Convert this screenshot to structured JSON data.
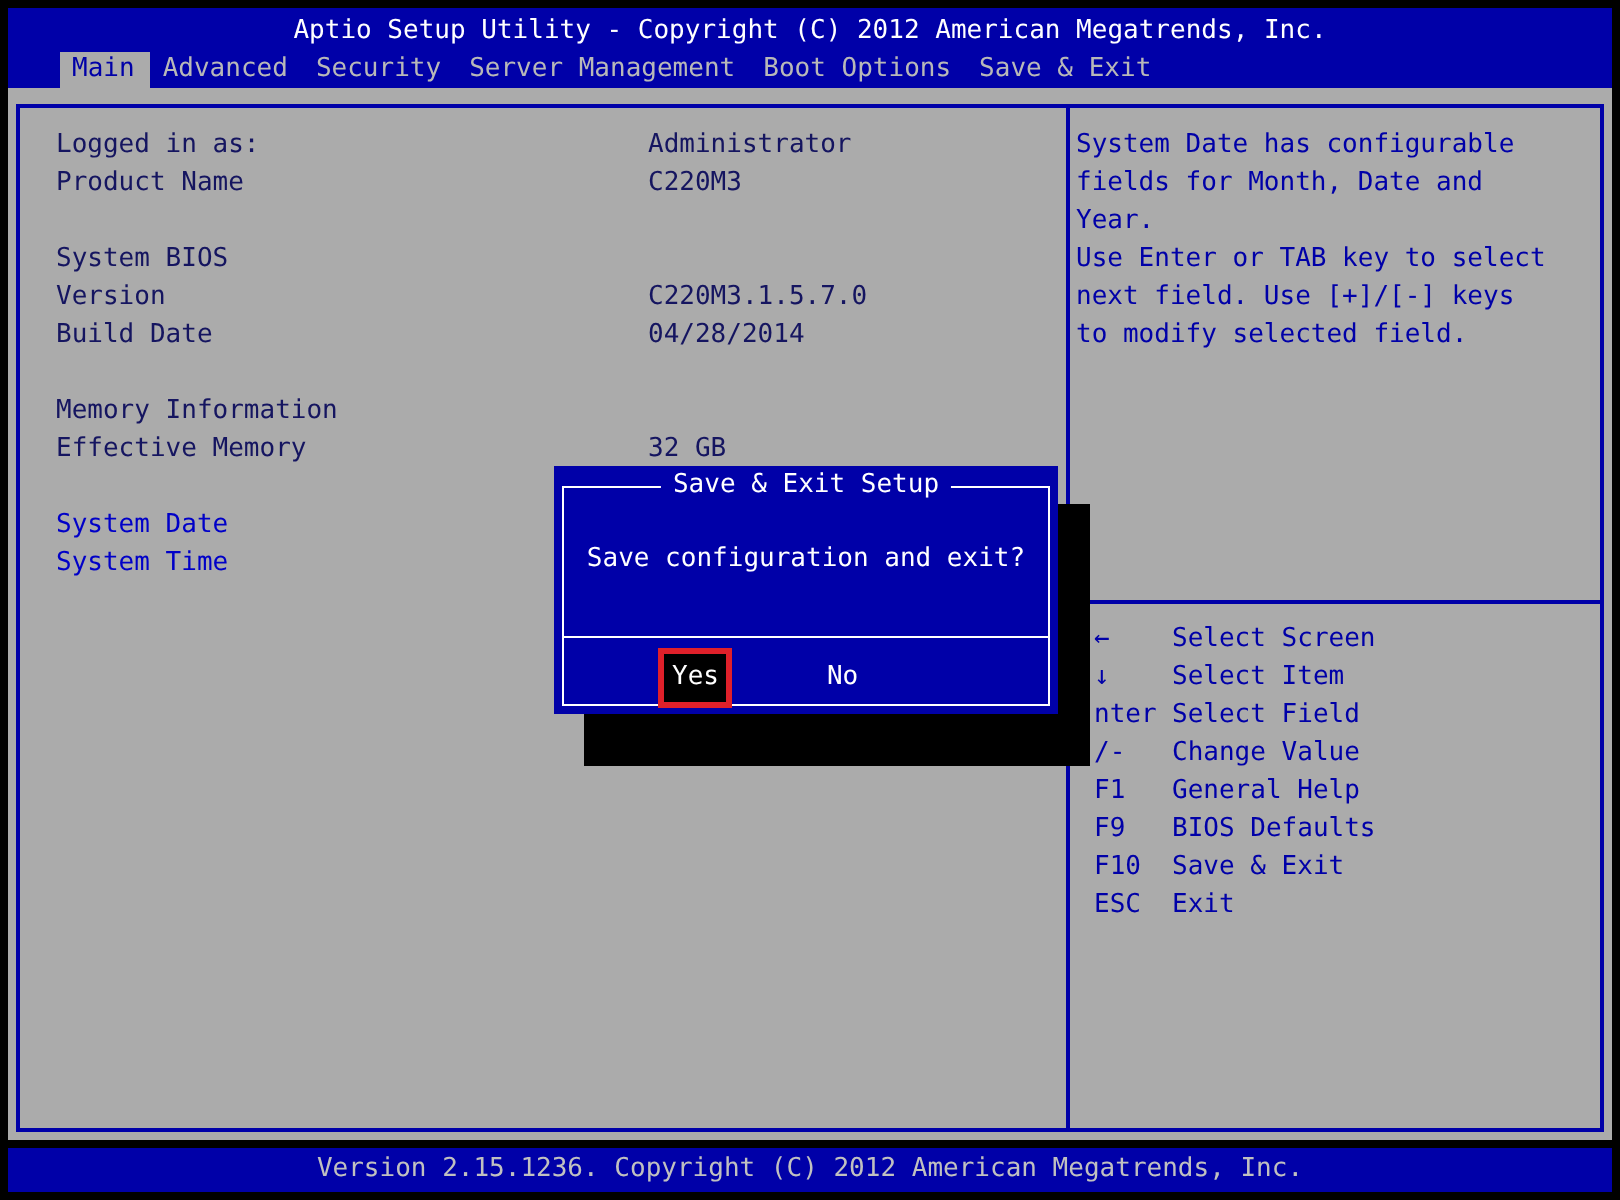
{
  "window": {
    "title": "Aptio Setup Utility - Copyright (C) 2012 American Megatrends, Inc."
  },
  "tabs": [
    {
      "label": "Main",
      "selected": true
    },
    {
      "label": "Advanced",
      "selected": false
    },
    {
      "label": "Security",
      "selected": false
    },
    {
      "label": "Server Management",
      "selected": false
    },
    {
      "label": "Boot Options",
      "selected": false
    },
    {
      "label": "Save & Exit",
      "selected": false
    }
  ],
  "settings": [
    [
      {
        "label": "Logged in as:",
        "value": "Administrator",
        "kind": "info"
      },
      {
        "label": "Product Name",
        "value": "C220M3",
        "kind": "info"
      }
    ],
    [
      {
        "label": "System BIOS",
        "kind": "info"
      },
      {
        "label": "Version",
        "value": "C220M3.1.5.7.0",
        "kind": "info"
      },
      {
        "label": "Build Date",
        "value": "04/28/2014",
        "kind": "info"
      }
    ],
    [
      {
        "label": "Memory Information",
        "kind": "info"
      },
      {
        "label": "Effective Memory",
        "value": "32 GB",
        "kind": "info"
      }
    ],
    [
      {
        "label": "System Date",
        "kind": "editable"
      },
      {
        "label": "System Time",
        "kind": "editable"
      }
    ]
  ],
  "help_text": "System Date has configurable fields for Month, Date and Year.\nUse Enter or TAB key to select next field. Use [+]/[-] keys to modify selected field.",
  "key_help": [
    {
      "key": "←",
      "action": "Select Screen"
    },
    {
      "key": "↓",
      "action": "Select Item"
    },
    {
      "key": "nter",
      "action": "Select Field"
    },
    {
      "key": "/-",
      "action": "Change Value"
    },
    {
      "key": "F1",
      "action": "General Help"
    },
    {
      "key": "F9",
      "action": "BIOS Defaults"
    },
    {
      "key": "F10",
      "action": "Save & Exit"
    },
    {
      "key": "ESC",
      "action": "Exit"
    }
  ],
  "dialog": {
    "title": "Save & Exit Setup",
    "message": "Save configuration and exit?",
    "buttons": [
      {
        "label": "Yes",
        "selected": true
      },
      {
        "label": "No",
        "selected": false
      }
    ]
  },
  "status_bar": "Version 2.15.1236. Copyright (C) 2012 American Megatrends, Inc."
}
